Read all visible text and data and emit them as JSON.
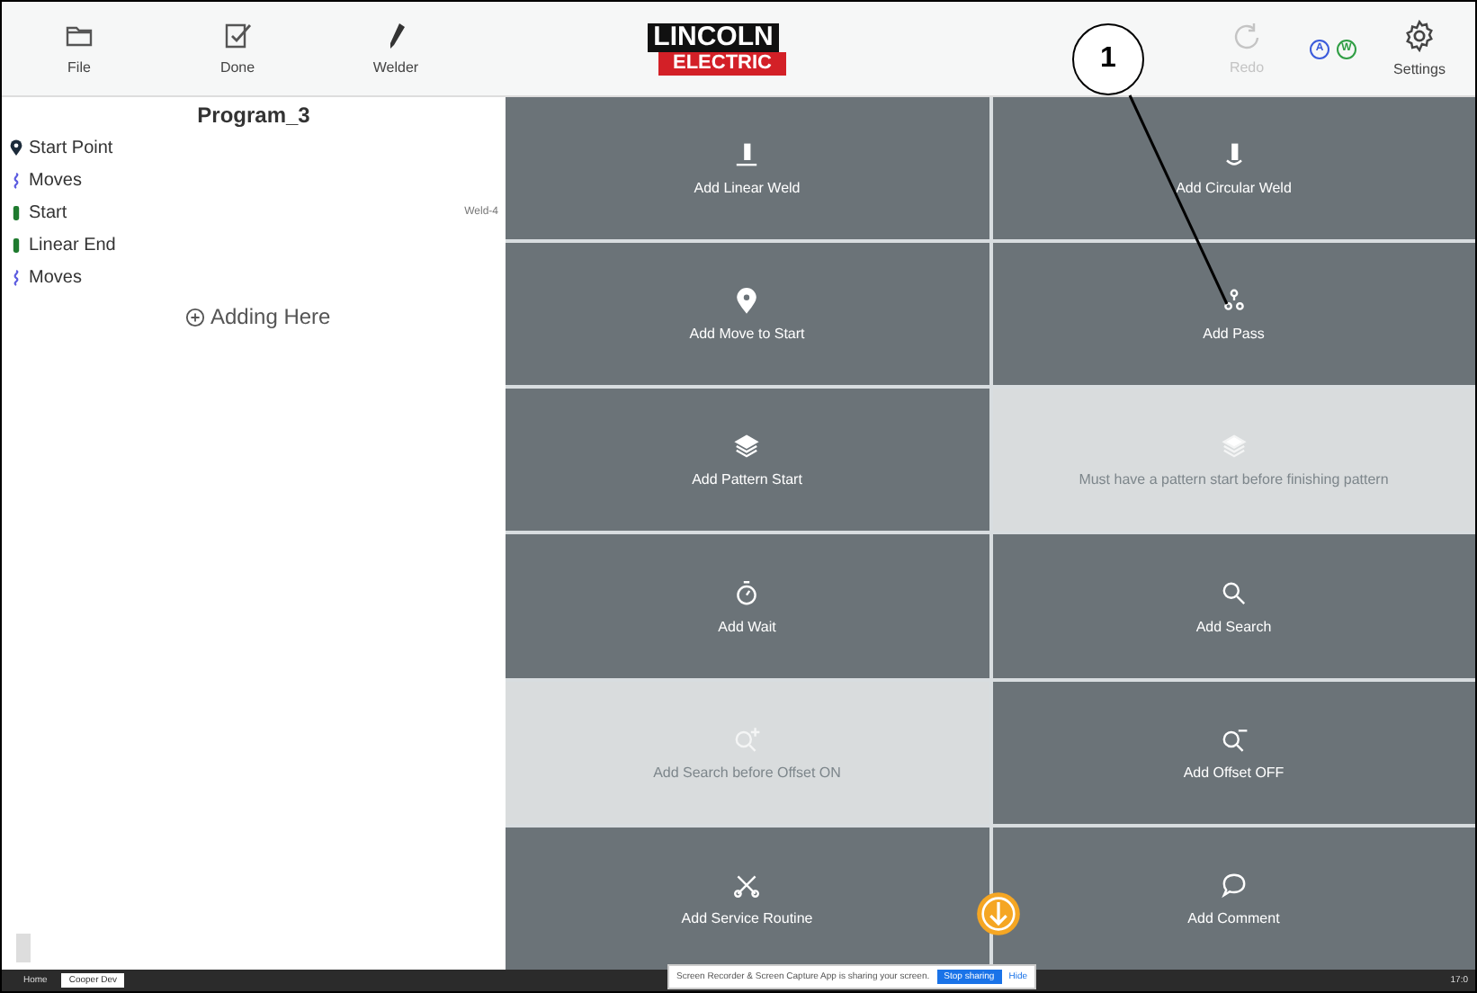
{
  "toolbar": {
    "left": [
      {
        "label": "File",
        "kind": "folder"
      },
      {
        "label": "Done",
        "kind": "check"
      },
      {
        "label": "Welder",
        "kind": "torch"
      }
    ],
    "logo": {
      "top": "LINCOLN",
      "bottom": "ELECTRIC"
    },
    "redo": {
      "label": "Redo",
      "disabled": true
    },
    "badges": [
      {
        "letter": "A",
        "color": "#3b5bdb"
      },
      {
        "letter": "W",
        "color": "#2f9e44"
      }
    ],
    "settings": {
      "label": "Settings"
    }
  },
  "program": {
    "title": "Program_3",
    "items": [
      {
        "label": "Start Point",
        "kind": "point"
      },
      {
        "label": "Moves",
        "kind": "moves"
      },
      {
        "label": "Start",
        "kind": "weld",
        "tag": "Weld-4"
      },
      {
        "label": "Linear End",
        "kind": "weld"
      },
      {
        "label": "Moves",
        "kind": "moves"
      }
    ],
    "adding": "Adding Here"
  },
  "tiles": [
    {
      "label": "Add Linear Weld",
      "kind": "linear",
      "disabled": false
    },
    {
      "label": "Add Circular Weld",
      "kind": "circular",
      "disabled": false
    },
    {
      "label": "Add Move to Start",
      "kind": "pin",
      "disabled": false
    },
    {
      "label": "Add Pass",
      "kind": "pass",
      "disabled": false
    },
    {
      "label": "Add Pattern Start",
      "kind": "layers",
      "disabled": false
    },
    {
      "label": "Must have a pattern start before finishing pattern",
      "kind": "layers",
      "disabled": true
    },
    {
      "label": "Add Wait",
      "kind": "timer",
      "disabled": false
    },
    {
      "label": "Add Search",
      "kind": "search",
      "disabled": false
    },
    {
      "label": "Add Search before Offset ON",
      "kind": "search-plus",
      "disabled": true
    },
    {
      "label": "Add Offset OFF",
      "kind": "search-minus",
      "disabled": false
    },
    {
      "label": "Add Service Routine",
      "kind": "tools",
      "disabled": false
    },
    {
      "label": "Add Comment",
      "kind": "comment",
      "disabled": false
    }
  ],
  "callout": {
    "number": "1"
  },
  "taskbar": {
    "home": "Home",
    "app": "Cooper Dev",
    "notice": "Screen Recorder & Screen Capture App is sharing your screen.",
    "stop": "Stop sharing",
    "hide": "Hide",
    "time": "17:0"
  }
}
